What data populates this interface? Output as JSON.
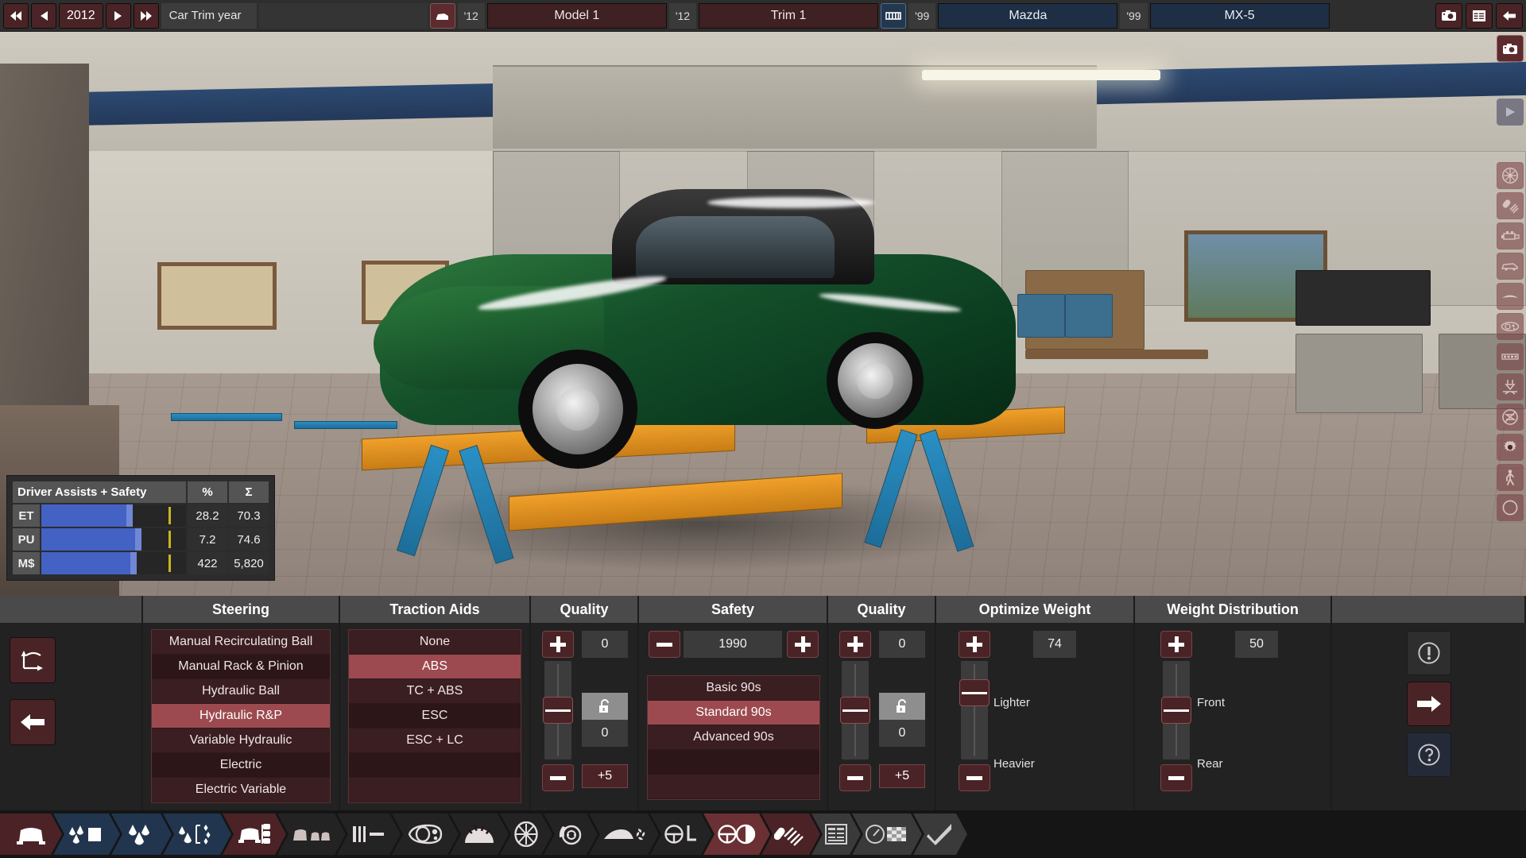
{
  "topbar": {
    "nav": {
      "first_label": "⏮",
      "prev_label": "◀",
      "next_label": "▶",
      "last_label": "⏭"
    },
    "year": "2012",
    "year_label": "Car Trim year",
    "model_tag": "'12",
    "model_name": "Model 1",
    "trim_tag": "'12",
    "trim_name": "Trim 1",
    "platform_tag": "'99",
    "brand_name": "Mazda",
    "family_tag": "'99",
    "family_name": "MX-5",
    "right_icons": [
      "camera-icon",
      "table-icon",
      "back-arrow-icon"
    ]
  },
  "stats": {
    "title": "Driver Assists + Safety",
    "col_percent": "%",
    "col_sum": "Σ",
    "rows": [
      {
        "label": "ET",
        "percent": "28.2",
        "sum": "70.3",
        "bar_pct": 84,
        "mark_pct": 100
      },
      {
        "label": "PU",
        "percent": "7.2",
        "sum": "74.6",
        "bar_pct": 92,
        "mark_pct": 100
      },
      {
        "label": "M$",
        "percent": "422",
        "sum": "5,820",
        "bar_pct": 88,
        "mark_pct": 100
      }
    ]
  },
  "left_tools": {
    "reset_camera_label": "reset-rotation-icon",
    "back_label": "back-arrow-icon"
  },
  "right_tools": {
    "warning_label": "warning-icon",
    "forward_label": "forward-arrow-icon",
    "help_label": "help-icon"
  },
  "panel": {
    "headers": [
      "",
      "Steering",
      "Traction Aids",
      "Quality",
      "Safety",
      "Quality",
      "Optimize Weight",
      "Weight Distribution",
      ""
    ],
    "steering": {
      "title": "Steering",
      "options": [
        "Manual Recirculating Ball",
        "Manual Rack & Pinion",
        "Hydraulic Ball",
        "Hydraulic R&P",
        "Variable Hydraulic",
        "Electric",
        "Electric Variable"
      ],
      "selected": "Hydraulic R&P"
    },
    "traction": {
      "title": "Traction Aids",
      "options": [
        "None",
        "ABS",
        "TC + ABS",
        "ESC",
        "ESC + LC",
        "",
        ""
      ],
      "selected": "ABS"
    },
    "quality_left": {
      "title": "Quality",
      "plus": "+",
      "minus": "−",
      "value_top": "0",
      "value_bottom": "0",
      "bonus": "+5",
      "lock_icon": "unlocked-padlock-icon",
      "slider_pos_pct": 50
    },
    "safety": {
      "title": "Safety",
      "year_minus": "−",
      "year_value": "1990",
      "year_plus": "+",
      "options": [
        "Basic 90s",
        "Standard 90s",
        "Advanced 90s",
        "",
        ""
      ],
      "selected": "Standard 90s"
    },
    "quality_right": {
      "title": "Quality",
      "plus": "+",
      "minus": "−",
      "value_top": "0",
      "value_bottom": "0",
      "bonus": "+5",
      "lock_icon": "unlocked-padlock-icon",
      "slider_pos_pct": 50
    },
    "optimize_weight": {
      "title": "Optimize Weight",
      "plus": "+",
      "minus": "−",
      "value": "74",
      "label_high": "Lighter",
      "label_low": "Heavier",
      "slider_pos_pct": 74
    },
    "weight_distribution": {
      "title": "Weight Distribution",
      "plus": "+",
      "minus": "−",
      "value": "50",
      "label_high": "Front",
      "label_low": "Rear",
      "slider_pos_pct": 50
    }
  },
  "rail": {
    "items": [
      "camera-icon",
      "play-icon",
      "wheel-icon",
      "suspension-icon",
      "engine-icon",
      "car-body-icon",
      "aero-icon",
      "headlight-icon",
      "interior-icon",
      "crash-test-icon",
      "no-entry-icon",
      "gear-icon",
      "pedestrian-icon",
      "circle-icon"
    ]
  },
  "taskbar": {
    "items": [
      {
        "name": "car-overview-icon",
        "state": "red"
      },
      {
        "name": "fuel-book-icon",
        "state": "blue"
      },
      {
        "name": "fuel-drops-icon",
        "state": "blue"
      },
      {
        "name": "fuel-quality-icon",
        "state": "blue"
      },
      {
        "name": "chassis-icon",
        "state": "red"
      },
      {
        "name": "seats-icon",
        "state": "dark"
      },
      {
        "name": "interior-equipment-icon",
        "state": "dark"
      },
      {
        "name": "headlights-icon",
        "state": "dark"
      },
      {
        "name": "gearbox-icon",
        "state": "dark"
      },
      {
        "name": "wheels-icon",
        "state": "dark"
      },
      {
        "name": "brakes-icon",
        "state": "dark"
      },
      {
        "name": "aerodynamics-icon",
        "state": "dark"
      },
      {
        "name": "steering-assist-icon",
        "state": "dark"
      },
      {
        "name": "driver-assists-icon",
        "state": "red-lite"
      },
      {
        "name": "suspension-icon",
        "state": "red"
      },
      {
        "name": "stats-table-icon",
        "state": "grey"
      },
      {
        "name": "test-track-icon",
        "state": "grey"
      },
      {
        "name": "confirm-check-icon",
        "state": "grey"
      }
    ]
  }
}
